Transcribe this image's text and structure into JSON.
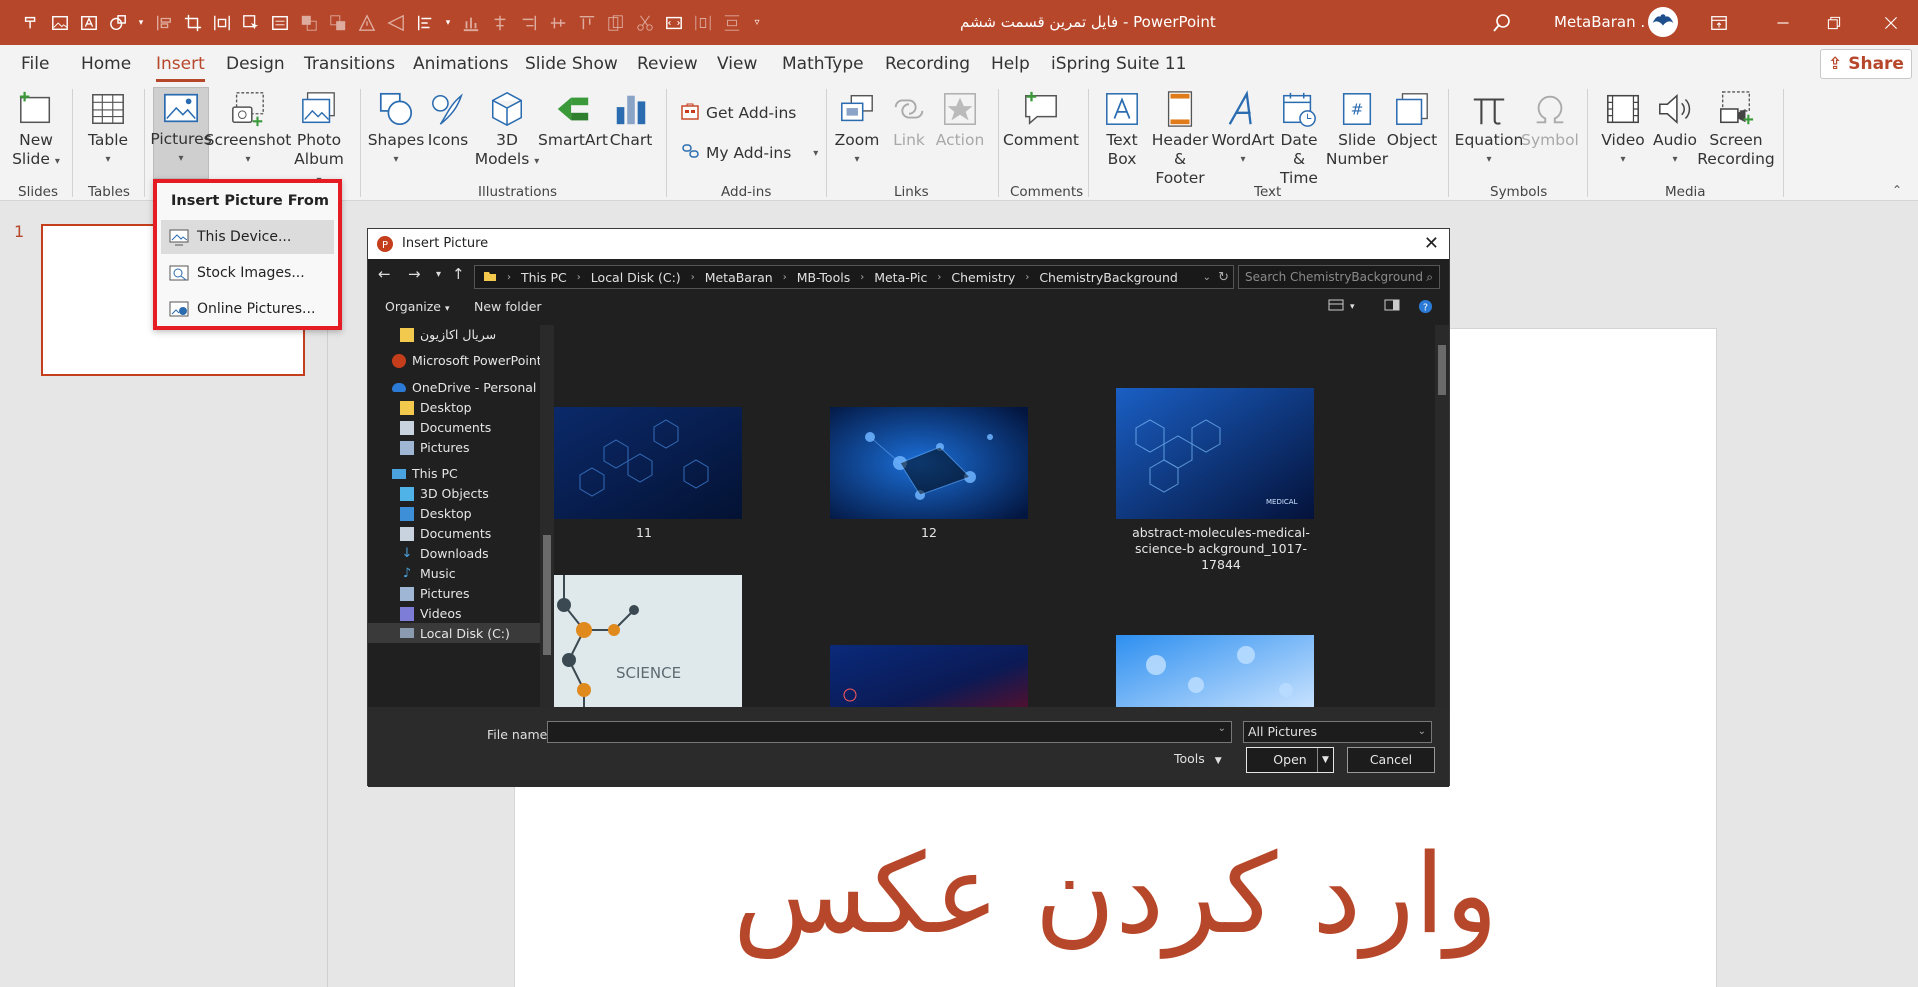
{
  "window": {
    "title": "فایل تمرین قسمت ششم - PowerPoint",
    "user_name": "MetaBaran .",
    "accent": "#b7472a"
  },
  "tabs": [
    "File",
    "Home",
    "Insert",
    "Design",
    "Transitions",
    "Animations",
    "Slide Show",
    "Review",
    "View",
    "MathType",
    "Recording",
    "Help",
    "iSpring Suite 11"
  ],
  "active_tab": "Insert",
  "share_label": "Share",
  "ribbon": {
    "new_slide": [
      "New",
      "Slide"
    ],
    "table": "Table",
    "pictures": "Pictures",
    "screenshot": "Screenshot",
    "photo_album": [
      "Photo",
      "Album"
    ],
    "shapes": "Shapes",
    "icons": "Icons",
    "models_3d": [
      "3D",
      "Models"
    ],
    "smartart": "SmartArt",
    "chart": "Chart",
    "get_addins": "Get Add-ins",
    "my_addins": "My Add-ins",
    "zoom": "Zoom",
    "link": "Link",
    "action": "Action",
    "comment": "Comment",
    "text_box": [
      "Text",
      "Box"
    ],
    "header_footer": [
      "Header",
      "& Footer"
    ],
    "wordart": "WordArt",
    "date_time": [
      "Date &",
      "Time"
    ],
    "slide_number": [
      "Slide",
      "Number"
    ],
    "object": "Object",
    "equation": "Equation",
    "symbol": "Symbol",
    "video": "Video",
    "audio": "Audio",
    "screen_recording": [
      "Screen",
      "Recording"
    ],
    "groups": {
      "slides": "Slides",
      "tables": "Tables",
      "illustrations": "Illustrations",
      "addins": "Add-ins",
      "links": "Links",
      "comments": "Comments",
      "text": "Text",
      "symbols": "Symbols",
      "media": "Media"
    }
  },
  "dropdown": {
    "header": "Insert Picture From",
    "items": [
      "This Device...",
      "Stock Images...",
      "Online Pictures..."
    ]
  },
  "slide_panel": {
    "number": "1"
  },
  "slide": {
    "title": "وارد کردن عکس"
  },
  "dialog": {
    "title": "Insert Picture",
    "breadcrumb": [
      "This PC",
      "Local Disk (C:)",
      "MetaBaran",
      "MB-Tools",
      "Meta-Pic",
      "Chemistry",
      "ChemistryBackground"
    ],
    "search_placeholder": "Search ChemistryBackground",
    "organize": "Organize",
    "new_folder": "New folder",
    "nav": [
      {
        "label": "سریال اکازیون",
        "icon": "folder-icon"
      },
      {
        "label": "Microsoft PowerPoint",
        "icon": "powerpoint-icon"
      },
      {
        "label": "OneDrive - Personal",
        "icon": "cloud-icon"
      },
      {
        "label": "Desktop",
        "icon": "folder-icon"
      },
      {
        "label": "Documents",
        "icon": "documents-icon"
      },
      {
        "label": "Pictures",
        "icon": "pictures-icon"
      },
      {
        "label": "This PC",
        "icon": "computer-icon"
      },
      {
        "label": "3D Objects",
        "icon": "cube-icon"
      },
      {
        "label": "Desktop",
        "icon": "folder-icon"
      },
      {
        "label": "Documents",
        "icon": "documents-icon"
      },
      {
        "label": "Downloads",
        "icon": "download-icon"
      },
      {
        "label": "Music",
        "icon": "music-icon"
      },
      {
        "label": "Pictures",
        "icon": "pictures-icon"
      },
      {
        "label": "Videos",
        "icon": "video-icon"
      },
      {
        "label": "Local Disk (C:)",
        "icon": "drive-icon"
      }
    ],
    "files": [
      {
        "name": "11"
      },
      {
        "name": "12"
      },
      {
        "name": "abstract-molecules-medical-science-b ackground_1017-17844"
      },
      {
        "name": ""
      },
      {
        "name": ""
      },
      {
        "name": ""
      }
    ],
    "thumb_text": {
      "science": "SCIENCE",
      "medical": "MEDICAL"
    },
    "file_name_label": "File name:",
    "file_name_value": "",
    "file_type": "All Pictures",
    "tools": "Tools",
    "open": "Open",
    "cancel": "Cancel"
  }
}
